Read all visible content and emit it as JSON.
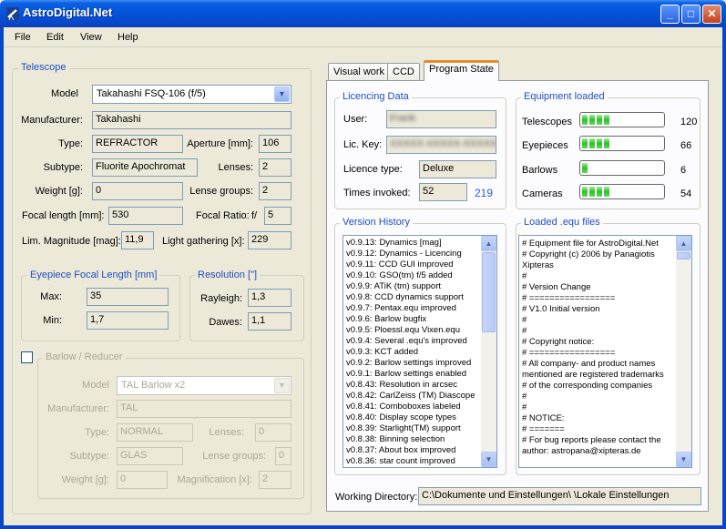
{
  "window": {
    "title": "AstroDigital.Net"
  },
  "menu": {
    "items": [
      "File",
      "Edit",
      "View",
      "Help"
    ]
  },
  "telescope": {
    "legend": "Telescope",
    "model_label": "Model",
    "model_value": "Takahashi FSQ-106 (f/5)",
    "manufacturer_label": "Manufacturer:",
    "manufacturer_value": "Takahashi",
    "type_label": "Type:",
    "type_value": "REFRACTOR",
    "aperture_label": "Aperture [mm]:",
    "aperture_value": "106",
    "subtype_label": "Subtype:",
    "subtype_value": "Fluorite Apochromat",
    "lenses_label": "Lenses:",
    "lenses_value": "2",
    "weight_label": "Weight [g]:",
    "weight_value": "0",
    "lense_groups_label": "Lense groups:",
    "lense_groups_value": "2",
    "focal_length_label": "Focal length [mm]:",
    "focal_length_value": "530",
    "focal_ratio_label": "Focal Ratio:",
    "focal_ratio_prefix": "f/",
    "focal_ratio_value": "5",
    "lim_mag_label": "Lim. Magnitude [mag]:",
    "lim_mag_value": "11,9",
    "light_gathering_label": "Light gathering [x]:",
    "light_gathering_value": "229"
  },
  "eyepiece": {
    "legend": "Eyepiece Focal Length [mm]",
    "max_label": "Max:",
    "max_value": "35",
    "min_label": "Min:",
    "min_value": "1,7"
  },
  "resolution": {
    "legend": "Resolution [\"]",
    "rayleigh_label": "Rayleigh:",
    "rayleigh_value": "1,3",
    "dawes_label": "Dawes:",
    "dawes_value": "1,1"
  },
  "barlow": {
    "legend": "Barlow / Reducer",
    "checked": false,
    "model_label": "Model",
    "model_value": "TAL Barlow x2",
    "manufacturer_label": "Manufacturer:",
    "manufacturer_value": "TAL",
    "type_label": "Type:",
    "type_value": "NORMAL",
    "lenses_label": "Lenses:",
    "lenses_value": "0",
    "subtype_label": "Subtype:",
    "subtype_value": "GLAS",
    "lense_groups_label": "Lense groups:",
    "lense_groups_value": "0",
    "weight_label": "Weight [g]:",
    "weight_value": "0",
    "magnification_label": "Magnification [x]:",
    "magnification_value": "2"
  },
  "tabs": [
    {
      "label": "Visual work",
      "active": false
    },
    {
      "label": "CCD",
      "active": false
    },
    {
      "label": "Program State",
      "active": true
    }
  ],
  "licencing": {
    "legend": "Licencing Data",
    "user_label": "User:",
    "user_value": "Frank",
    "key_label": "Lic. Key:",
    "key_value": "XXXXX-XXXXX-XXXXX",
    "type_label": "Licence type:",
    "type_value": "Deluxe",
    "invoked_label": "Times invoked:",
    "invoked_value": "52",
    "invoked_link": "219"
  },
  "equipment": {
    "legend": "Equipment loaded",
    "items": [
      {
        "label": "Telescopes",
        "count": "120",
        "level": 0.35
      },
      {
        "label": "Eyepieces",
        "count": "66",
        "level": 0.35
      },
      {
        "label": "Barlows",
        "count": "6",
        "level": 0.08
      },
      {
        "label": "Cameras",
        "count": "54",
        "level": 0.35
      }
    ]
  },
  "version_history": {
    "legend": "Version History",
    "lines": [
      "v0.9.13: Dynamics [mag]",
      "v0.9.12: Dynamics - Licencing",
      "v0.9.11: CCD GUI improved",
      "v0.9.10: GSO(tm) f/5 added",
      "v0.9.9: ATiK (tm) support",
      "v0.9.8: CCD dynamics support",
      "v0.9.7: Pentax.equ improved",
      "v0.9.6: Barlow bugfix",
      "v0.9.5: Ploessl.equ Vixen.equ",
      "v0.9.4: Several .equ's improved",
      "v0.9.3: KCT added",
      "v0.9.2: Barlow settings improved",
      "v0.9.1: Barlow settings enabled",
      "v0.8.43: Resolution in arcsec",
      "v0.8.42: CarlZeiss (TM) Diascope",
      "v0.8.41: Comboboxes labeled",
      "v0.8.40: Display scope types",
      "v0.8.39: Starlight(TM) support",
      "v0.8.38: Binning selection",
      "v0.8.37: About box improved",
      "v0.8.36: star count improved"
    ]
  },
  "equ_files": {
    "legend": "Loaded .equ files",
    "lines": [
      "# Equipment file for AstroDigital.Net",
      "# Copyright (c) 2006 by Panagiotis",
      "Xipteras",
      "#",
      "# Version    Change",
      "# =================",
      "# V1.0       Initial version",
      "#",
      "#",
      "# Copyright notice:",
      "# =================",
      "# All company- and product names",
      "mentioned are registered trademarks",
      "# of the corresponding companies",
      "#",
      "#",
      "# NOTICE:",
      "# =======",
      "# For bug reports please contact the",
      "author: astropana@xipteras.de"
    ]
  },
  "working_dir": {
    "label": "Working Directory:",
    "value": "C:\\Dokumente und Einstellungen\\         \\Lokale Einstellungen"
  }
}
